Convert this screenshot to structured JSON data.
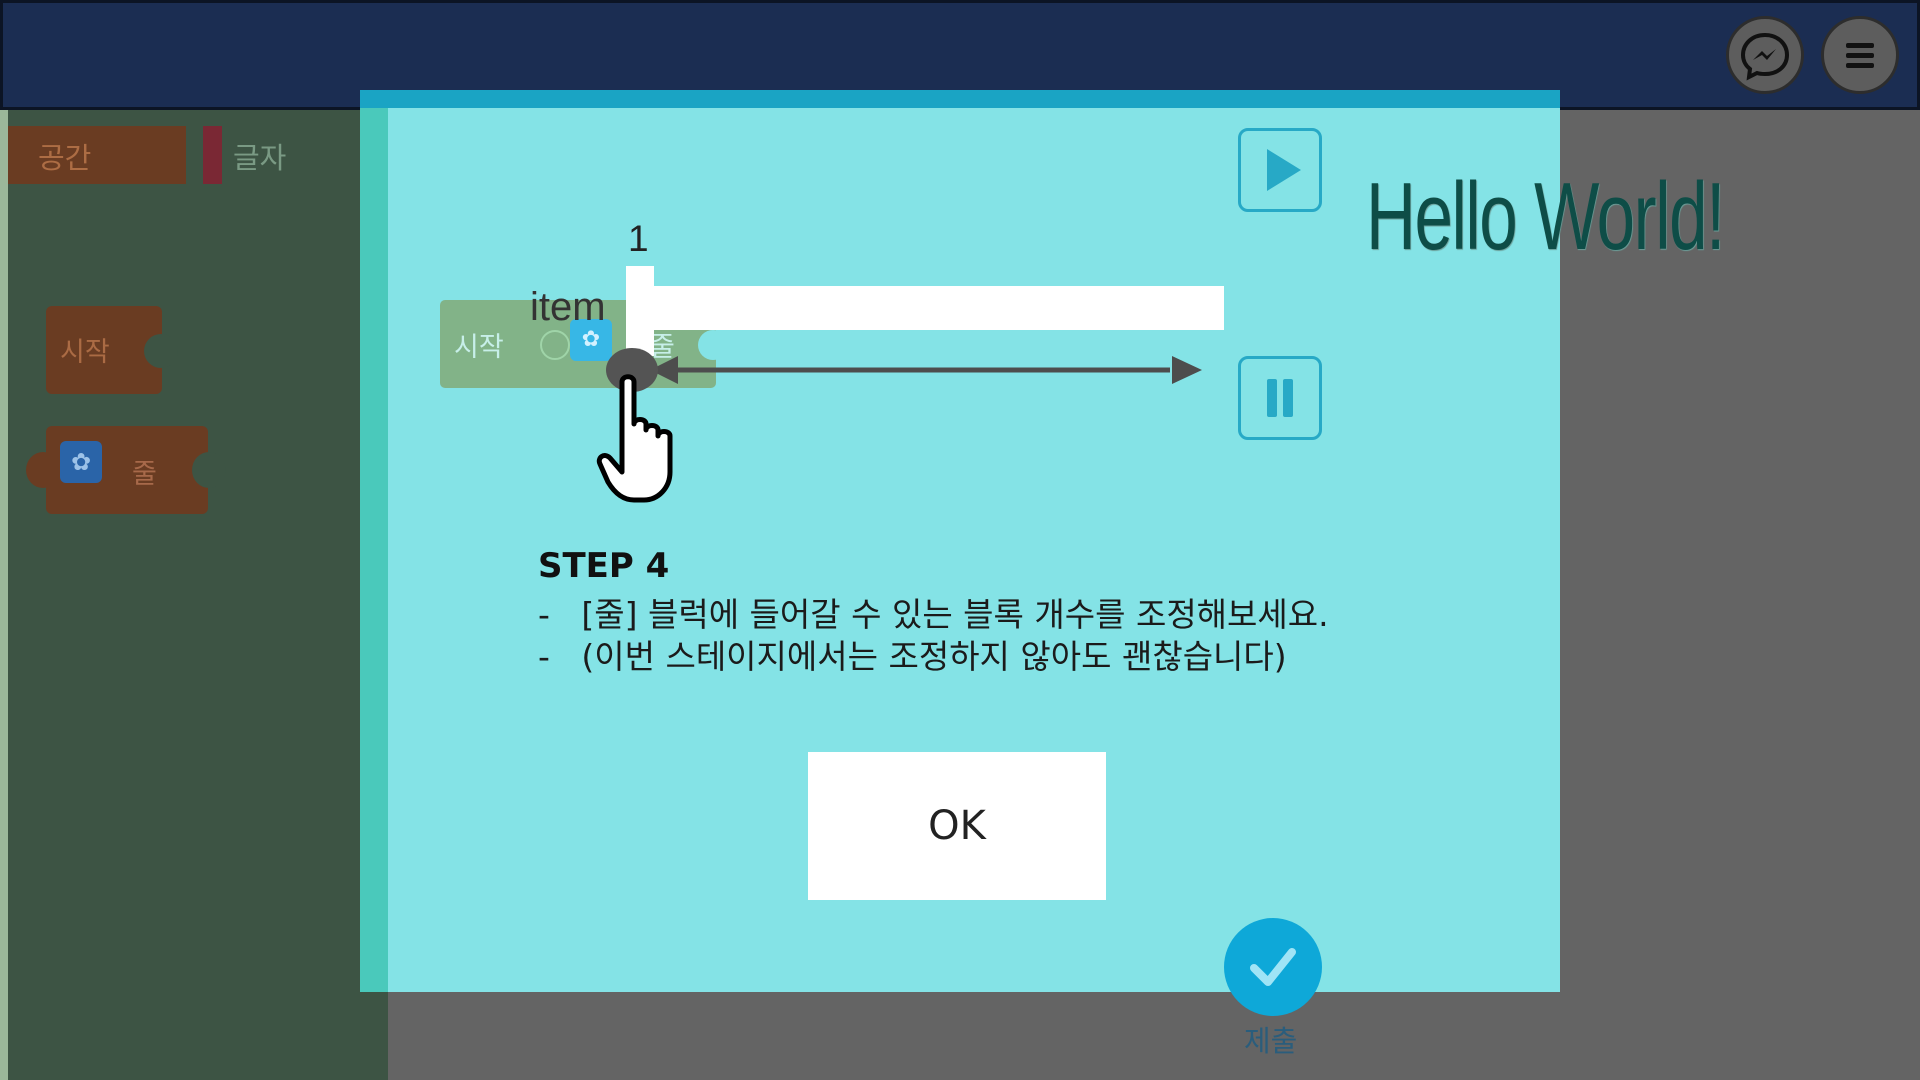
{
  "toolbox": {
    "categories": [
      {
        "label": "공간",
        "color": "#6a3c22"
      },
      {
        "label": "글자",
        "color": "#7a2834"
      }
    ],
    "blocks": [
      {
        "label": "시작"
      },
      {
        "label": "줄",
        "icon": "gear-icon"
      }
    ]
  },
  "header": {
    "buttons": [
      {
        "name": "messenger",
        "icon": "messenger-icon"
      },
      {
        "name": "menu",
        "icon": "hamburger-menu-icon"
      }
    ]
  },
  "stage": {
    "output_text": "Hello World!"
  },
  "submit": {
    "label": "제출",
    "icon": "checkmark-icon"
  },
  "tutorial": {
    "demo": {
      "block_label": "시작",
      "line_block_label": "줄",
      "item_label": "item",
      "count_label": "1",
      "pointer": "hand-pointer-icon"
    },
    "controls": {
      "play_icon": "play-icon",
      "pause_icon": "pause-icon"
    },
    "step_title": "STEP 4",
    "lines": [
      "-   [줄] 블럭에 들어갈 수 있는 블록 개수를 조정해보세요.",
      "-   (이번 스테이지에서는 조정하지 않아도 괜찮습니다)"
    ],
    "ok_label": "OK"
  },
  "colors": {
    "header_bg": "#1b2d52",
    "modal_bg": "#84e3e6",
    "accent": "#0ea8d8",
    "block_brown": "#6a3c22"
  }
}
